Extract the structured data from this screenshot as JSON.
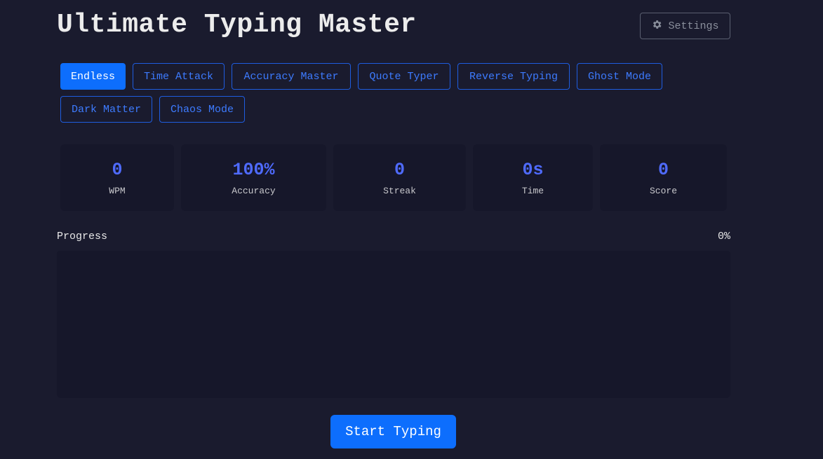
{
  "app": {
    "title": "Ultimate Typing Master"
  },
  "header": {
    "settings_label": "Settings",
    "settings_icon": "gear-icon"
  },
  "modes": [
    {
      "label": "Endless",
      "active": true
    },
    {
      "label": "Time Attack",
      "active": false
    },
    {
      "label": "Accuracy Master",
      "active": false
    },
    {
      "label": "Quote Typer",
      "active": false
    },
    {
      "label": "Reverse Typing",
      "active": false
    },
    {
      "label": "Ghost Mode",
      "active": false
    },
    {
      "label": "Dark Matter",
      "active": false
    },
    {
      "label": "Chaos Mode",
      "active": false
    }
  ],
  "stats": [
    {
      "value": "0",
      "label": "WPM"
    },
    {
      "value": "100%",
      "label": "Accuracy"
    },
    {
      "value": "0",
      "label": "Streak"
    },
    {
      "value": "0s",
      "label": "Time"
    },
    {
      "value": "0",
      "label": "Score"
    }
  ],
  "progress": {
    "label": "Progress",
    "percent_text": "0%",
    "value": 0
  },
  "actions": {
    "start_label": "Start Typing"
  },
  "colors": {
    "background": "#1a1b2e",
    "panel": "#16172a",
    "accent": "#0d6efd",
    "stat_value": "#4f6bff"
  }
}
